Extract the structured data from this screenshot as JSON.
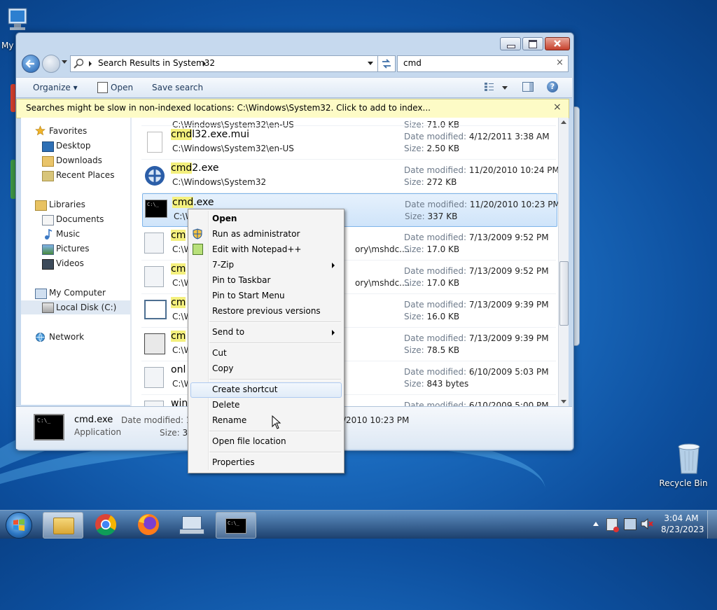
{
  "desktop": {
    "computer_icon_label": "My",
    "recycle_label": "Recycle Bin"
  },
  "window": {
    "breadcrumb": "Search Results in System32",
    "search_value": "cmd",
    "toolbar": {
      "organize": "Organize",
      "open": "Open",
      "save_search": "Save search"
    },
    "infobar": "Searches might be slow in non-indexed locations: C:\\Windows\\System32. Click to add to index...",
    "nav": {
      "favorites": "Favorites",
      "desktop": "Desktop",
      "downloads": "Downloads",
      "recent": "Recent Places",
      "libraries": "Libraries",
      "documents": "Documents",
      "music": "Music",
      "pictures": "Pictures",
      "videos": "Videos",
      "computer": "My Computer",
      "localdisk": "Local Disk (C:)",
      "network": "Network"
    },
    "labels": {
      "date_modified": "Date modified:",
      "size": "Size:"
    },
    "top_partial": {
      "path": "C:\\Windows\\System32\\en-US",
      "size": "71.0 KB"
    },
    "files": [
      {
        "hl": "cmd",
        "rest": "l32.exe.mui",
        "path": "C:\\Windows\\System32\\en-US",
        "date": "4/12/2011 3:38 AM",
        "size": "2.50 KB"
      },
      {
        "hl": "cmd",
        "rest": "2.exe",
        "path": "C:\\Windows\\System32",
        "date": "11/20/2010 10:24 PM",
        "size": "272 KB"
      },
      {
        "hl": "cmd",
        "rest": ".exe",
        "path": "C:\\W",
        "date": "11/20/2010 10:23 PM",
        "size": "337 KB"
      },
      {
        "hl": "cm",
        "rest": "",
        "path": "C:\\W",
        "path_tail": "ory\\mshdc....",
        "date": "7/13/2009 9:52 PM",
        "size": "17.0 KB"
      },
      {
        "hl": "cm",
        "rest": "",
        "path": "C:\\W",
        "path_tail": "ory\\mshdc....",
        "date": "7/13/2009 9:52 PM",
        "size": "17.0 KB"
      },
      {
        "hl": "cm",
        "rest": "",
        "path": "C:\\W",
        "date": "7/13/2009 9:39 PM",
        "size": "16.0 KB"
      },
      {
        "hl": "cm",
        "rest": "",
        "path": "C:\\W",
        "date": "7/13/2009 9:39 PM",
        "size": "78.5 KB"
      },
      {
        "hl": "",
        "rest": "onl",
        "path": "C:\\W",
        "date": "6/10/2009 5:03 PM",
        "size": "843 bytes"
      },
      {
        "hl": "",
        "rest": "win",
        "path": "",
        "date": "6/10/2009 5:00 PM",
        "size": ""
      }
    ],
    "details": {
      "name": "cmd.exe",
      "type": "Application",
      "date_label": "Date modified:",
      "date_partial": "11",
      "date_tail": "/2010 10:23 PM",
      "size_label": "Size:",
      "size_partial": "33"
    }
  },
  "context_menu": {
    "open": "Open",
    "run_admin": "Run as administrator",
    "notepad": "Edit with Notepad++",
    "zip": "7-Zip",
    "pin_taskbar": "Pin to Taskbar",
    "pin_start": "Pin to Start Menu",
    "restore": "Restore previous versions",
    "send_to": "Send to",
    "cut": "Cut",
    "copy": "Copy",
    "create_shortcut": "Create shortcut",
    "delete": "Delete",
    "rename": "Rename",
    "open_location": "Open file location",
    "properties": "Properties"
  },
  "taskbar": {
    "time": "3:04 AM",
    "date": "8/23/2023"
  }
}
